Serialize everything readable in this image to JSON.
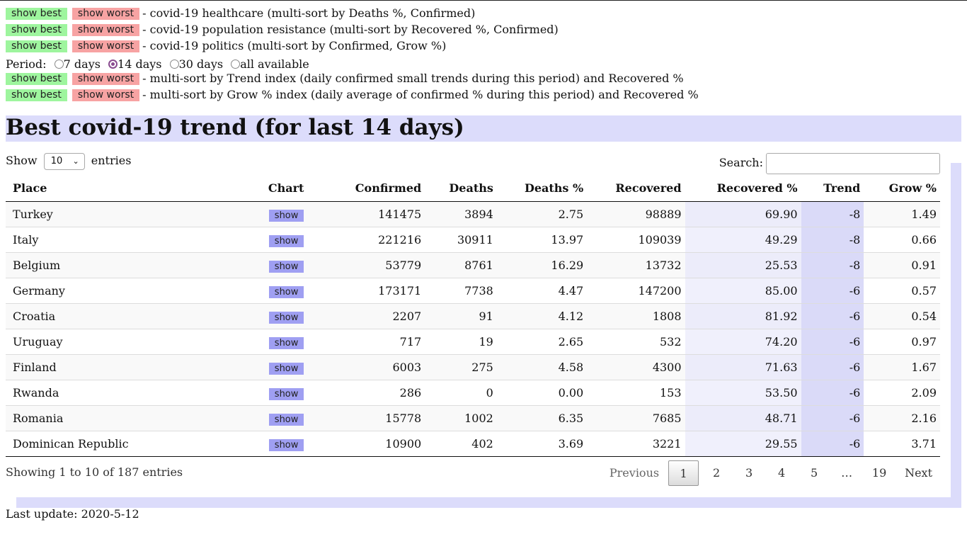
{
  "top_rows": [
    {
      "best": "show best",
      "worst": "show worst",
      "desc": "- covid-19 healthcare (multi-sort by Deaths %, Confirmed)"
    },
    {
      "best": "show best",
      "worst": "show worst",
      "desc": "- covid-19 population resistance (multi-sort by Recovered %, Confirmed)"
    },
    {
      "best": "show best",
      "worst": "show worst",
      "desc": "- covid-19 politics (multi-sort by Confirmed, Grow %)"
    }
  ],
  "period": {
    "label": "Period:",
    "options": [
      "7 days",
      "14 days",
      "30 days",
      "all available"
    ],
    "selected": "14 days"
  },
  "period_rows": [
    {
      "best": "show best",
      "worst": "show worst",
      "desc": "- multi-sort by Trend index (daily confirmed small trends during this period) and Recovered %"
    },
    {
      "best": "show best",
      "worst": "show worst",
      "desc": "- multi-sort by Grow % index (daily average of confirmed % during this period) and Recovered %"
    }
  ],
  "heading": "Best covid-19 trend (for last 14 days)",
  "length": {
    "show": "Show",
    "value": "10",
    "entries": "entries"
  },
  "search": {
    "label": "Search:",
    "value": ""
  },
  "table": {
    "headers": [
      "Place",
      "Chart",
      "Confirmed",
      "Deaths",
      "Deaths %",
      "Recovered",
      "Recovered %",
      "Trend",
      "Grow %"
    ],
    "chart_label": "show",
    "rows": [
      [
        "Turkey",
        "141475",
        "3894",
        "2.75",
        "98889",
        "69.90",
        "-8",
        "1.49"
      ],
      [
        "Italy",
        "221216",
        "30911",
        "13.97",
        "109039",
        "49.29",
        "-8",
        "0.66"
      ],
      [
        "Belgium",
        "53779",
        "8761",
        "16.29",
        "13732",
        "25.53",
        "-8",
        "0.91"
      ],
      [
        "Germany",
        "173171",
        "7738",
        "4.47",
        "147200",
        "85.00",
        "-6",
        "0.57"
      ],
      [
        "Croatia",
        "2207",
        "91",
        "4.12",
        "1808",
        "81.92",
        "-6",
        "0.54"
      ],
      [
        "Uruguay",
        "717",
        "19",
        "2.65",
        "532",
        "74.20",
        "-6",
        "0.97"
      ],
      [
        "Finland",
        "6003",
        "275",
        "4.58",
        "4300",
        "71.63",
        "-6",
        "1.67"
      ],
      [
        "Rwanda",
        "286",
        "0",
        "0.00",
        "153",
        "53.50",
        "-6",
        "2.09"
      ],
      [
        "Romania",
        "15778",
        "1002",
        "6.35",
        "7685",
        "48.71",
        "-6",
        "2.16"
      ],
      [
        "Dominican Republic",
        "10900",
        "402",
        "3.69",
        "3221",
        "29.55",
        "-6",
        "3.71"
      ]
    ]
  },
  "info": "Showing 1 to 10 of 187 entries",
  "pagination": {
    "previous": "Previous",
    "pages": [
      "1",
      "2",
      "3",
      "4",
      "5",
      "…",
      "19"
    ],
    "current": "1",
    "next": "Next"
  },
  "footer": "Last update: 2020-5-12",
  "colors": {
    "best_button": "#9ef59e",
    "worst_button": "#f7a3a3",
    "chart_button": "#9f9ff2",
    "heading_band": "#dcdcfb",
    "radio_selected": "#8a4c90"
  }
}
